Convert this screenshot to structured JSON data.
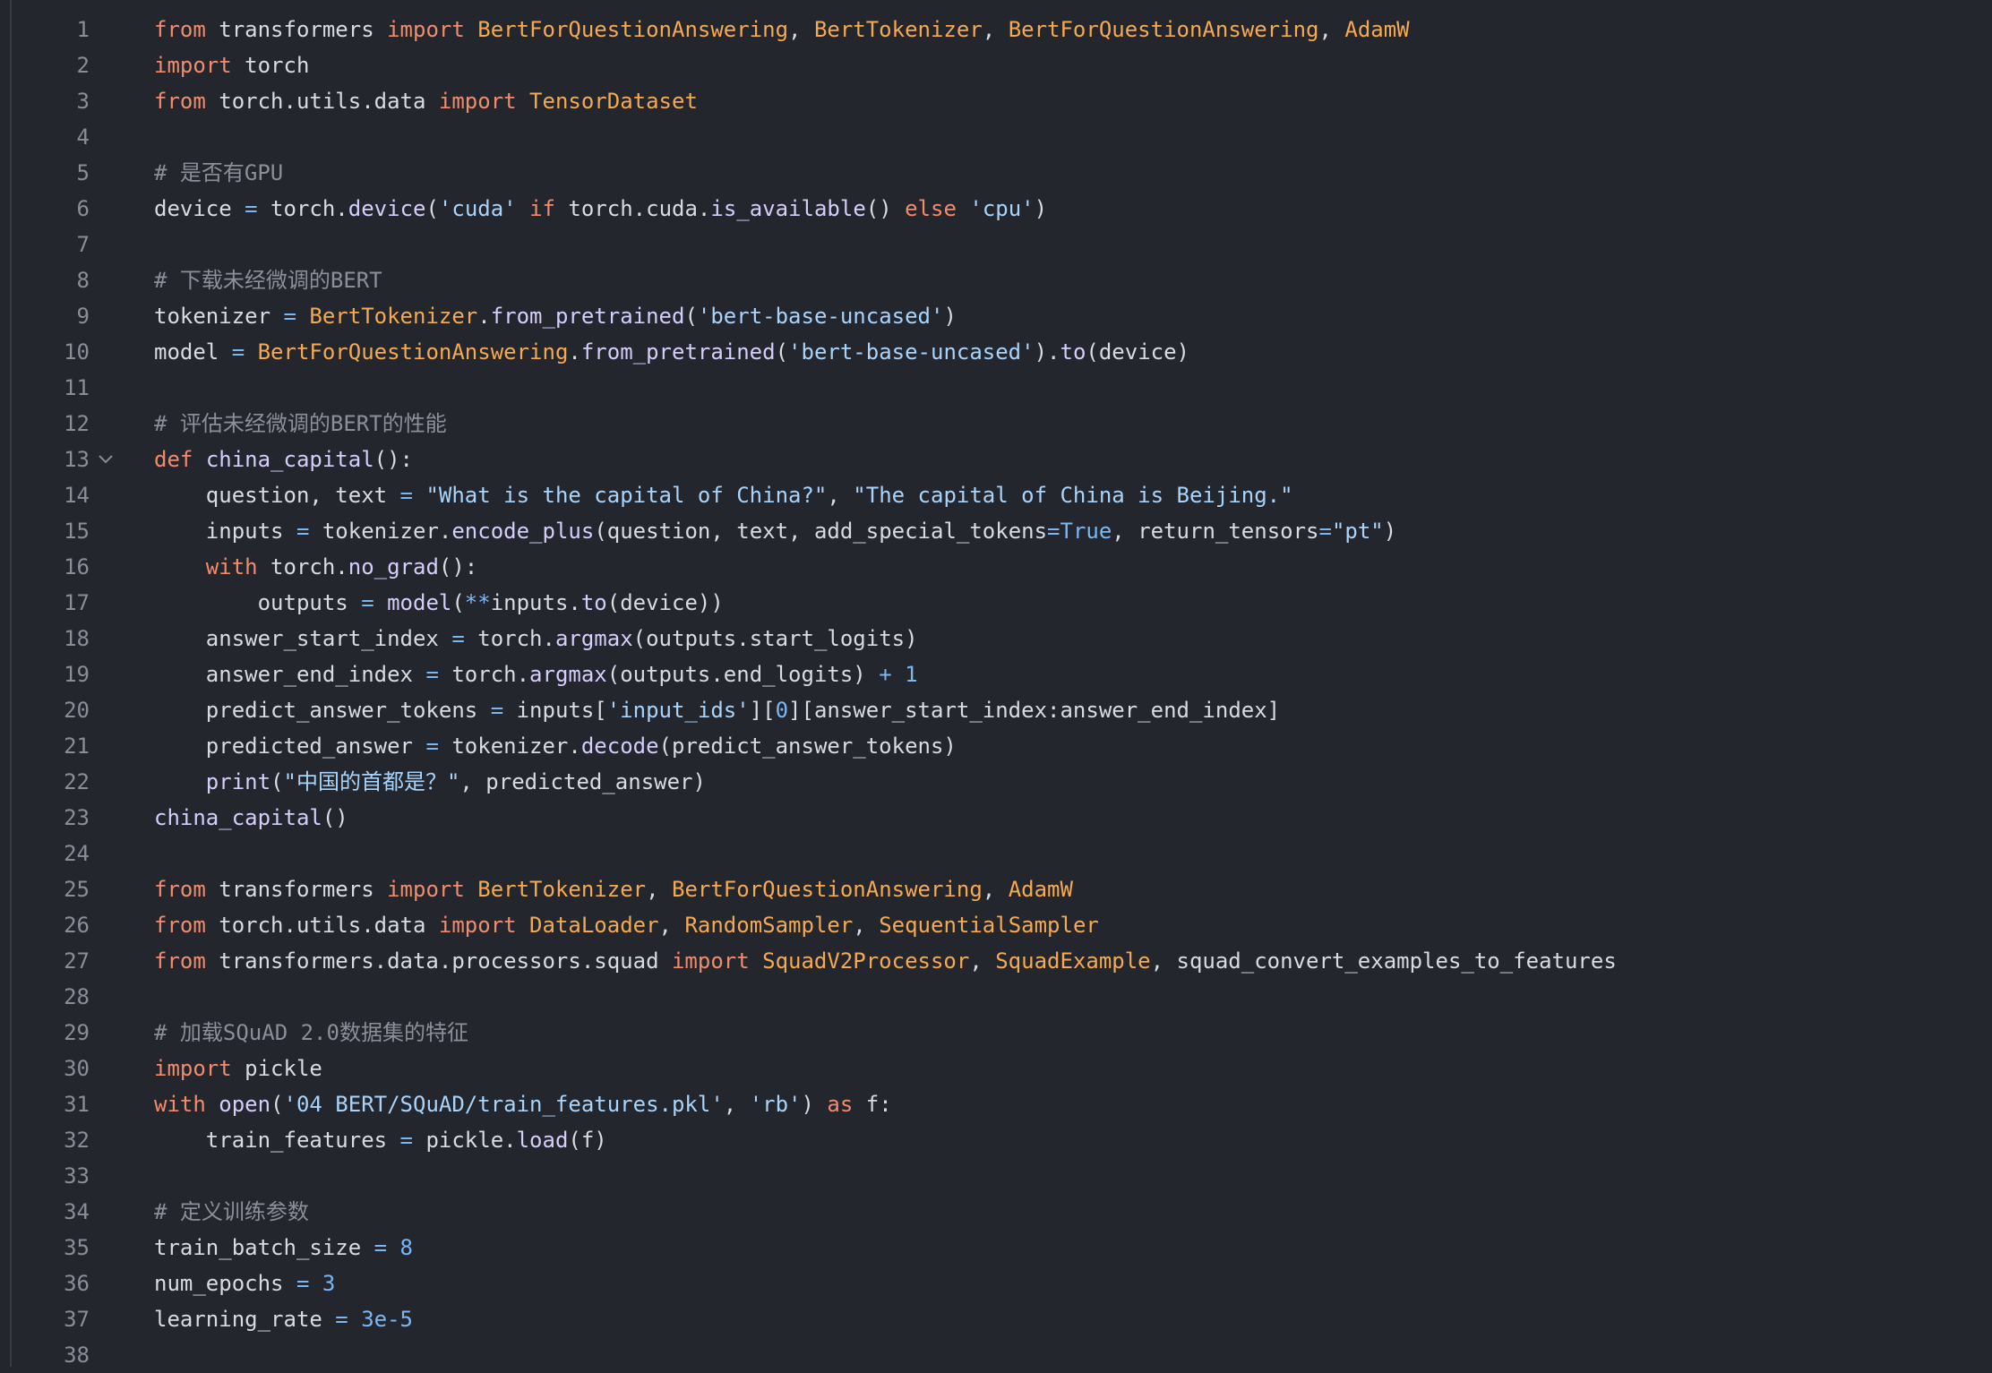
{
  "editor": {
    "lines": [
      {
        "n": "1",
        "tokens": [
          {
            "t": "from",
            "c": "kw"
          },
          {
            "t": " transformers ",
            "c": "pl"
          },
          {
            "t": "import",
            "c": "kw"
          },
          {
            "t": " ",
            "c": "pl"
          },
          {
            "t": "BertForQuestionAnswering",
            "c": "cls"
          },
          {
            "t": ", ",
            "c": "pl"
          },
          {
            "t": "BertTokenizer",
            "c": "cls"
          },
          {
            "t": ", ",
            "c": "pl"
          },
          {
            "t": "BertForQuestionAnswering",
            "c": "cls"
          },
          {
            "t": ", ",
            "c": "pl"
          },
          {
            "t": "AdamW",
            "c": "cls"
          }
        ]
      },
      {
        "n": "2",
        "tokens": [
          {
            "t": "import",
            "c": "kw"
          },
          {
            "t": " torch",
            "c": "pl"
          }
        ]
      },
      {
        "n": "3",
        "tokens": [
          {
            "t": "from",
            "c": "kw"
          },
          {
            "t": " torch.utils.data ",
            "c": "pl"
          },
          {
            "t": "import",
            "c": "kw"
          },
          {
            "t": " ",
            "c": "pl"
          },
          {
            "t": "TensorDataset",
            "c": "cls"
          }
        ]
      },
      {
        "n": "4",
        "tokens": []
      },
      {
        "n": "5",
        "tokens": [
          {
            "t": "# 是否有GPU",
            "c": "cmt"
          }
        ]
      },
      {
        "n": "6",
        "tokens": [
          {
            "t": "device ",
            "c": "pl"
          },
          {
            "t": "=",
            "c": "op"
          },
          {
            "t": " torch.",
            "c": "pl"
          },
          {
            "t": "device",
            "c": "fnc"
          },
          {
            "t": "(",
            "c": "pl"
          },
          {
            "t": "'cuda'",
            "c": "str"
          },
          {
            "t": " ",
            "c": "pl"
          },
          {
            "t": "if",
            "c": "kw"
          },
          {
            "t": " torch.cuda.",
            "c": "pl"
          },
          {
            "t": "is_available",
            "c": "fnc"
          },
          {
            "t": "() ",
            "c": "pl"
          },
          {
            "t": "else",
            "c": "kw"
          },
          {
            "t": " ",
            "c": "pl"
          },
          {
            "t": "'cpu'",
            "c": "str"
          },
          {
            "t": ")",
            "c": "pl"
          }
        ]
      },
      {
        "n": "7",
        "tokens": []
      },
      {
        "n": "8",
        "tokens": [
          {
            "t": "# 下载未经微调的BERT",
            "c": "cmt"
          }
        ]
      },
      {
        "n": "9",
        "tokens": [
          {
            "t": "tokenizer ",
            "c": "pl"
          },
          {
            "t": "=",
            "c": "op"
          },
          {
            "t": " ",
            "c": "pl"
          },
          {
            "t": "BertTokenizer",
            "c": "cls"
          },
          {
            "t": ".",
            "c": "pl"
          },
          {
            "t": "from_pretrained",
            "c": "fnc"
          },
          {
            "t": "(",
            "c": "pl"
          },
          {
            "t": "'bert-base-uncased'",
            "c": "str"
          },
          {
            "t": ")",
            "c": "pl"
          }
        ]
      },
      {
        "n": "10",
        "tokens": [
          {
            "t": "model ",
            "c": "pl"
          },
          {
            "t": "=",
            "c": "op"
          },
          {
            "t": " ",
            "c": "pl"
          },
          {
            "t": "BertForQuestionAnswering",
            "c": "cls"
          },
          {
            "t": ".",
            "c": "pl"
          },
          {
            "t": "from_pretrained",
            "c": "fnc"
          },
          {
            "t": "(",
            "c": "pl"
          },
          {
            "t": "'bert-base-uncased'",
            "c": "str"
          },
          {
            "t": ").",
            "c": "pl"
          },
          {
            "t": "to",
            "c": "fnc"
          },
          {
            "t": "(device)",
            "c": "pl"
          }
        ]
      },
      {
        "n": "11",
        "tokens": []
      },
      {
        "n": "12",
        "tokens": [
          {
            "t": "# 评估未经微调的BERT的性能",
            "c": "cmt"
          }
        ]
      },
      {
        "n": "13",
        "fold": true,
        "tokens": [
          {
            "t": "def",
            "c": "kw"
          },
          {
            "t": " ",
            "c": "pl"
          },
          {
            "t": "china_capital",
            "c": "fnc"
          },
          {
            "t": "():",
            "c": "pl"
          }
        ]
      },
      {
        "n": "14",
        "tokens": [
          {
            "t": "    question, text ",
            "c": "pl"
          },
          {
            "t": "=",
            "c": "op"
          },
          {
            "t": " ",
            "c": "pl"
          },
          {
            "t": "\"What is the capital of China?\"",
            "c": "str"
          },
          {
            "t": ", ",
            "c": "pl"
          },
          {
            "t": "\"The capital of China is Beijing.\"",
            "c": "str"
          }
        ]
      },
      {
        "n": "15",
        "tokens": [
          {
            "t": "    inputs ",
            "c": "pl"
          },
          {
            "t": "=",
            "c": "op"
          },
          {
            "t": " tokenizer.",
            "c": "pl"
          },
          {
            "t": "encode_plus",
            "c": "fnc"
          },
          {
            "t": "(question, text, add_special_tokens",
            "c": "pl"
          },
          {
            "t": "=",
            "c": "op"
          },
          {
            "t": "True",
            "c": "num"
          },
          {
            "t": ", return_tensors",
            "c": "pl"
          },
          {
            "t": "=",
            "c": "op"
          },
          {
            "t": "\"pt\"",
            "c": "str"
          },
          {
            "t": ")",
            "c": "pl"
          }
        ]
      },
      {
        "n": "16",
        "tokens": [
          {
            "t": "    ",
            "c": "pl"
          },
          {
            "t": "with",
            "c": "kw"
          },
          {
            "t": " torch.",
            "c": "pl"
          },
          {
            "t": "no_grad",
            "c": "fnc"
          },
          {
            "t": "():",
            "c": "pl"
          }
        ]
      },
      {
        "n": "17",
        "tokens": [
          {
            "t": "        outputs ",
            "c": "pl"
          },
          {
            "t": "=",
            "c": "op"
          },
          {
            "t": " ",
            "c": "pl"
          },
          {
            "t": "model",
            "c": "fnc"
          },
          {
            "t": "(",
            "c": "pl"
          },
          {
            "t": "**",
            "c": "op"
          },
          {
            "t": "inputs.",
            "c": "pl"
          },
          {
            "t": "to",
            "c": "fnc"
          },
          {
            "t": "(device))",
            "c": "pl"
          }
        ]
      },
      {
        "n": "18",
        "tokens": [
          {
            "t": "    answer_start_index ",
            "c": "pl"
          },
          {
            "t": "=",
            "c": "op"
          },
          {
            "t": " torch.",
            "c": "pl"
          },
          {
            "t": "argmax",
            "c": "fnc"
          },
          {
            "t": "(outputs.start_logits)",
            "c": "pl"
          }
        ]
      },
      {
        "n": "19",
        "tokens": [
          {
            "t": "    answer_end_index ",
            "c": "pl"
          },
          {
            "t": "=",
            "c": "op"
          },
          {
            "t": " torch.",
            "c": "pl"
          },
          {
            "t": "argmax",
            "c": "fnc"
          },
          {
            "t": "(outputs.end_logits) ",
            "c": "pl"
          },
          {
            "t": "+",
            "c": "op"
          },
          {
            "t": " ",
            "c": "pl"
          },
          {
            "t": "1",
            "c": "num"
          }
        ]
      },
      {
        "n": "20",
        "tokens": [
          {
            "t": "    predict_answer_tokens ",
            "c": "pl"
          },
          {
            "t": "=",
            "c": "op"
          },
          {
            "t": " inputs[",
            "c": "pl"
          },
          {
            "t": "'input_ids'",
            "c": "str"
          },
          {
            "t": "][",
            "c": "pl"
          },
          {
            "t": "0",
            "c": "num"
          },
          {
            "t": "][answer_start_index:answer_end_index]",
            "c": "pl"
          }
        ]
      },
      {
        "n": "21",
        "tokens": [
          {
            "t": "    predicted_answer ",
            "c": "pl"
          },
          {
            "t": "=",
            "c": "op"
          },
          {
            "t": " tokenizer.",
            "c": "pl"
          },
          {
            "t": "decode",
            "c": "fnc"
          },
          {
            "t": "(predict_answer_tokens)",
            "c": "pl"
          }
        ]
      },
      {
        "n": "22",
        "tokens": [
          {
            "t": "    ",
            "c": "pl"
          },
          {
            "t": "print",
            "c": "fnc"
          },
          {
            "t": "(",
            "c": "pl"
          },
          {
            "t": "\"中国的首都是？\"",
            "c": "str"
          },
          {
            "t": ", predicted_answer)",
            "c": "pl"
          }
        ]
      },
      {
        "n": "23",
        "tokens": [
          {
            "t": "china_capital",
            "c": "fnc"
          },
          {
            "t": "()",
            "c": "pl"
          }
        ]
      },
      {
        "n": "24",
        "tokens": []
      },
      {
        "n": "25",
        "tokens": [
          {
            "t": "from",
            "c": "kw"
          },
          {
            "t": " transformers ",
            "c": "pl"
          },
          {
            "t": "import",
            "c": "kw"
          },
          {
            "t": " ",
            "c": "pl"
          },
          {
            "t": "BertTokenizer",
            "c": "cls"
          },
          {
            "t": ", ",
            "c": "pl"
          },
          {
            "t": "BertForQuestionAnswering",
            "c": "cls"
          },
          {
            "t": ", ",
            "c": "pl"
          },
          {
            "t": "AdamW",
            "c": "cls"
          }
        ]
      },
      {
        "n": "26",
        "tokens": [
          {
            "t": "from",
            "c": "kw"
          },
          {
            "t": " torch.utils.data ",
            "c": "pl"
          },
          {
            "t": "import",
            "c": "kw"
          },
          {
            "t": " ",
            "c": "pl"
          },
          {
            "t": "DataLoader",
            "c": "cls"
          },
          {
            "t": ", ",
            "c": "pl"
          },
          {
            "t": "RandomSampler",
            "c": "cls"
          },
          {
            "t": ", ",
            "c": "pl"
          },
          {
            "t": "SequentialSampler",
            "c": "cls"
          }
        ]
      },
      {
        "n": "27",
        "tokens": [
          {
            "t": "from",
            "c": "kw"
          },
          {
            "t": " transformers.data.processors.squad ",
            "c": "pl"
          },
          {
            "t": "import",
            "c": "kw"
          },
          {
            "t": " ",
            "c": "pl"
          },
          {
            "t": "SquadV2Processor",
            "c": "cls"
          },
          {
            "t": ", ",
            "c": "pl"
          },
          {
            "t": "SquadExample",
            "c": "cls"
          },
          {
            "t": ", squad_convert_examples_to_features",
            "c": "pl"
          }
        ]
      },
      {
        "n": "28",
        "tokens": []
      },
      {
        "n": "29",
        "tokens": [
          {
            "t": "# 加载SQuAD 2.0数据集的特征",
            "c": "cmt"
          }
        ]
      },
      {
        "n": "30",
        "tokens": [
          {
            "t": "import",
            "c": "kw"
          },
          {
            "t": " pickle",
            "c": "pl"
          }
        ]
      },
      {
        "n": "31",
        "tokens": [
          {
            "t": "with",
            "c": "kw"
          },
          {
            "t": " ",
            "c": "pl"
          },
          {
            "t": "open",
            "c": "fnc"
          },
          {
            "t": "(",
            "c": "pl"
          },
          {
            "t": "'04 BERT/SQuAD/train_features.pkl'",
            "c": "str"
          },
          {
            "t": ", ",
            "c": "pl"
          },
          {
            "t": "'rb'",
            "c": "str"
          },
          {
            "t": ") ",
            "c": "pl"
          },
          {
            "t": "as",
            "c": "kw"
          },
          {
            "t": " f:",
            "c": "pl"
          }
        ]
      },
      {
        "n": "32",
        "tokens": [
          {
            "t": "    train_features ",
            "c": "pl"
          },
          {
            "t": "=",
            "c": "op"
          },
          {
            "t": " pickle.",
            "c": "pl"
          },
          {
            "t": "load",
            "c": "fnc"
          },
          {
            "t": "(f)",
            "c": "pl"
          }
        ]
      },
      {
        "n": "33",
        "tokens": []
      },
      {
        "n": "34",
        "tokens": [
          {
            "t": "# 定义训练参数",
            "c": "cmt"
          }
        ]
      },
      {
        "n": "35",
        "tokens": [
          {
            "t": "train_batch_size ",
            "c": "pl"
          },
          {
            "t": "=",
            "c": "op"
          },
          {
            "t": " ",
            "c": "pl"
          },
          {
            "t": "8",
            "c": "num"
          }
        ]
      },
      {
        "n": "36",
        "tokens": [
          {
            "t": "num_epochs ",
            "c": "pl"
          },
          {
            "t": "=",
            "c": "op"
          },
          {
            "t": " ",
            "c": "pl"
          },
          {
            "t": "3",
            "c": "num"
          }
        ]
      },
      {
        "n": "37",
        "tokens": [
          {
            "t": "learning_rate ",
            "c": "pl"
          },
          {
            "t": "=",
            "c": "op"
          },
          {
            "t": " ",
            "c": "pl"
          },
          {
            "t": "3e-5",
            "c": "num"
          }
        ]
      },
      {
        "n": "38",
        "tokens": []
      }
    ]
  },
  "icons": {
    "fold": "chevron-down-icon"
  },
  "colors": {
    "background": "#24262e",
    "line_number": "#8a8d97",
    "keyword": "#f28b6c",
    "class_name": "#f5a950",
    "function": "#d5cdfa",
    "string": "#a8d4fb",
    "number": "#7ab8f5",
    "comment": "#8b8f99",
    "plain": "#d9dbe2"
  }
}
